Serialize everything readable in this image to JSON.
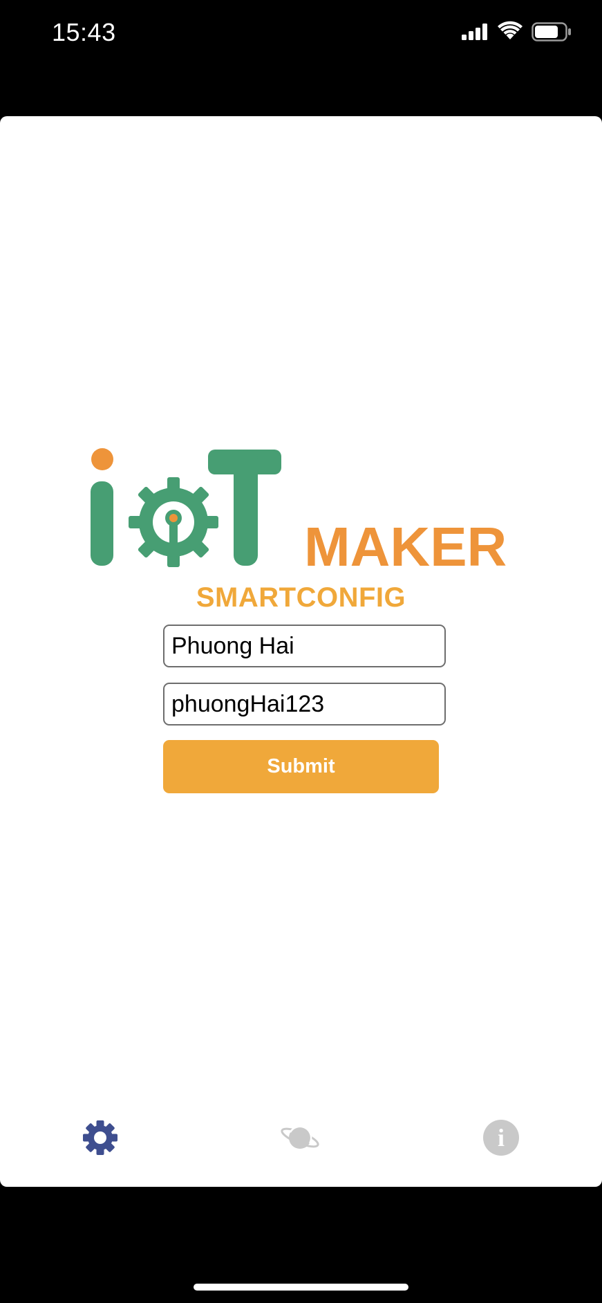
{
  "status_bar": {
    "time": "15:43"
  },
  "logo": {
    "brand_main": "IoT",
    "brand_suffix": "MAKER",
    "colors": {
      "green": "#479E73",
      "orange": "#EE943A"
    }
  },
  "form": {
    "title": "SMARTCONFIG",
    "ssid_value": "Phuong Hai",
    "password_value": "phuongHai123",
    "submit_label": "Submit"
  },
  "tab_bar": {
    "items": [
      {
        "name": "config",
        "icon": "gear-icon",
        "active": true
      },
      {
        "name": "planet",
        "icon": "planet-icon",
        "active": false
      },
      {
        "name": "info",
        "icon": "info-icon",
        "glyph": "i",
        "active": false
      }
    ]
  },
  "colors": {
    "accent": "#F0A83A",
    "active_tab": "#3E4E8F",
    "inactive_tab": "#C9C9C9"
  }
}
